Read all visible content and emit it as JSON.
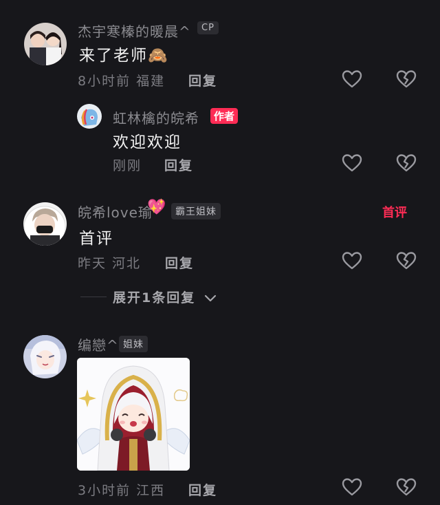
{
  "comments": [
    {
      "username": "杰宇寒榛的暖晨^",
      "badge": "CP",
      "text": "来了老师🙈",
      "time_location": "8小时前 福建",
      "reply_label": "回复"
    },
    {
      "username": "虹林檎的皖希",
      "badge": "作者",
      "text": "欢迎欢迎",
      "time_location": "刚刚",
      "reply_label": "回复"
    },
    {
      "username": "皖希love瑜",
      "username_emoji": "💖",
      "badge": "霸王姐妹",
      "tag": "首评",
      "text": "首评",
      "time_location": "昨天 河北",
      "reply_label": "回复",
      "expand_label": "展开1条回复"
    },
    {
      "username": "编戀^",
      "badge": "姐妹",
      "time_location": "3小时前 江西",
      "reply_label": "回复"
    }
  ],
  "colors": {
    "background": "#17171b",
    "accent": "#fe2c55",
    "muted_text": "#7c7c82"
  },
  "icons": [
    "heart-outline-icon",
    "broken-heart-icon",
    "chevron-down-icon"
  ]
}
